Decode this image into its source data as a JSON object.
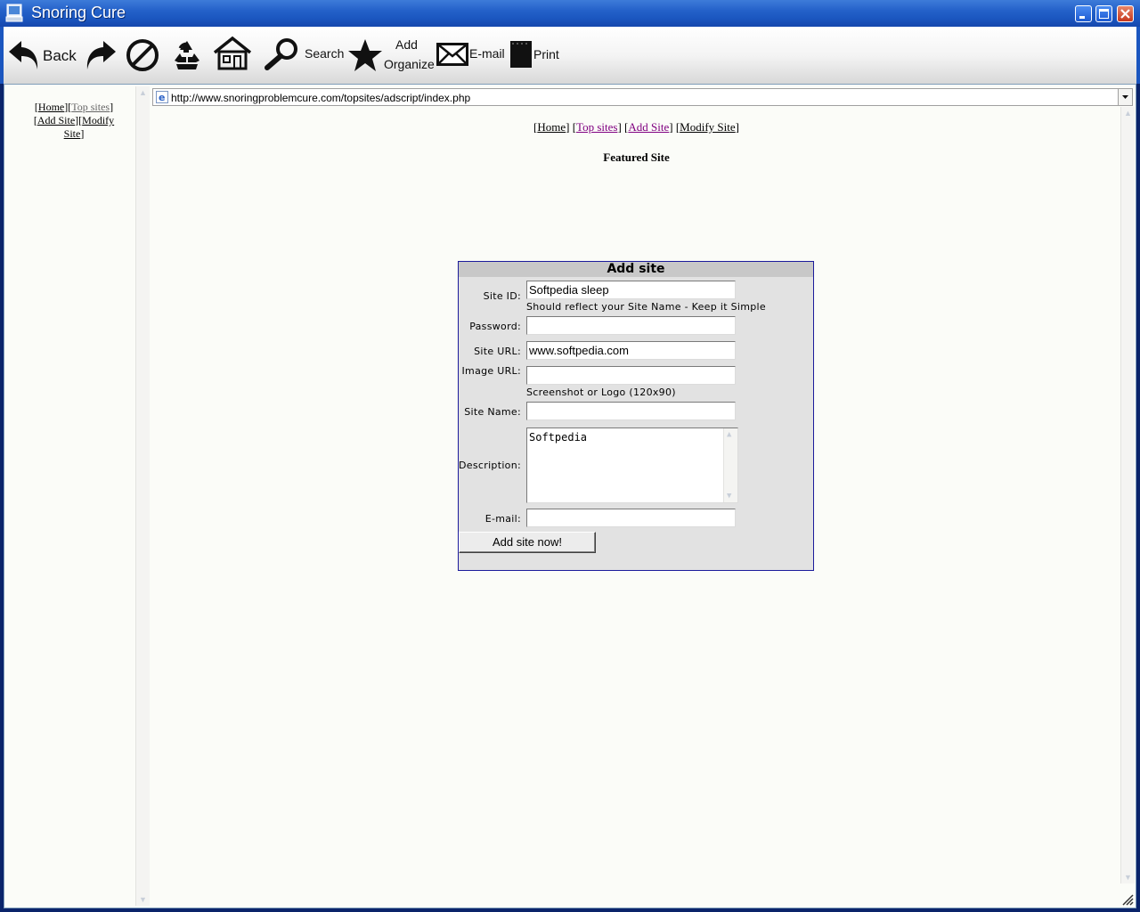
{
  "window": {
    "title": "Snoring Cure"
  },
  "toolbar": {
    "back_label": "Back",
    "search_label": "Search",
    "add_line1": "Add",
    "add_line2": "Organize",
    "email_label": "E-mail",
    "print_label": "Print"
  },
  "address": {
    "url": "http://www.snoringproblemcure.com/topsites/adscript/index.php"
  },
  "leftnav": {
    "home": "Home",
    "topsites": "Top sites",
    "addsite": "Add Site",
    "modify": "Modify",
    "site": "Site"
  },
  "topnav": {
    "home": "Home",
    "topsites": "Top sites",
    "addsite": "Add Site",
    "modifysite": "Modify Site"
  },
  "featured": "Featured Site",
  "form": {
    "title": "Add site",
    "siteid_label": "Site ID:",
    "siteid_value": "Softpedia sleep",
    "siteid_hint": "Should reflect your Site Name - Keep it Simple",
    "password_label": "Password:",
    "password_value": "",
    "siteurl_label": "Site URL:",
    "siteurl_value": "www.softpedia.com",
    "imageurl_label": "Image URL:",
    "imageurl_value": "",
    "imageurl_hint": "Screenshot or Logo (120x90)",
    "sitename_label": "Site Name:",
    "sitename_value": "",
    "description_label": "Description:",
    "description_value": "Softpedia",
    "email_label": "E-mail:",
    "email_value": "",
    "submit_label": "Add site now!"
  }
}
